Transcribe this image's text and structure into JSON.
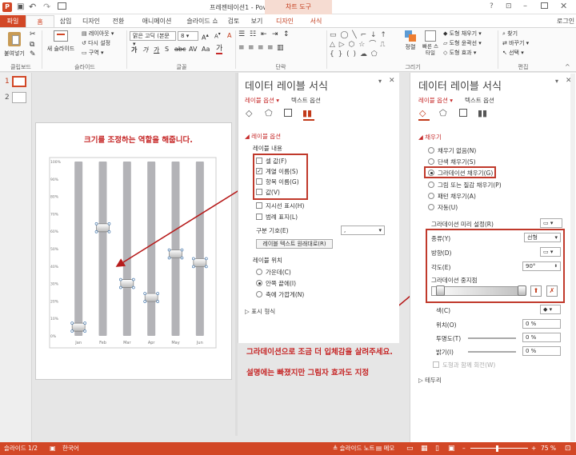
{
  "title": "프레젠테이션1 - PowerPoint",
  "chart_tools_label": "차트 도구",
  "user": "로그인",
  "tabs": [
    "파일",
    "홈",
    "삽입",
    "디자인",
    "전환",
    "애니메이션",
    "슬라이드 쇼",
    "검토",
    "보기",
    "디자인",
    "서식"
  ],
  "ribbon": {
    "paste": "붙여넣기",
    "clipboard": "클립보드",
    "new_slide": "새 슬라이드",
    "layout": "레이아웃",
    "reset": "다시 설정",
    "section": "구역",
    "slides_group": "슬라이드",
    "font_name": "맑은 고딕 (본문",
    "font_size": "8",
    "font_group": "글꼴",
    "paragraph_group": "단락",
    "drawing_group": "그리기",
    "arrange": "정렬",
    "quick_styles": "빠른 스타일",
    "shape_fill": "도형 채우기",
    "shape_outline": "도형 윤곽선",
    "shape_effects": "도형 효과",
    "find": "찾기",
    "replace": "바꾸기",
    "select": "선택",
    "editing_group": "편집"
  },
  "slide_numbers": [
    "1",
    "2"
  ],
  "annotations": {
    "top": "크기를 조정하는 역할을 해줍니다.",
    "bottom1": "그라데이션으로 조금 더 입체감을 살려주세요.",
    "bottom2": "설명에는 빠졌지만 그림자 효과도 지정"
  },
  "chart_data": {
    "type": "scatter",
    "categories": [
      "Jan",
      "Feb",
      "Mar",
      "Apr",
      "May",
      "Jun"
    ],
    "values": [
      5,
      62,
      30,
      22,
      47,
      42
    ],
    "ylim": [
      0,
      100
    ],
    "yticks": [
      "0%",
      "10%",
      "20%",
      "30%",
      "40%",
      "50%",
      "60%",
      "70%",
      "80%",
      "90%",
      "100%"
    ]
  },
  "pane1": {
    "title": "데이터 레이블 서식",
    "tab_label_options": "레이블 옵션",
    "tab_text_options": "텍스트 옵션",
    "section": "레이블 옵션",
    "label_contains": "레이블 내용",
    "checks": [
      {
        "label": "셀 값(F)",
        "checked": false
      },
      {
        "label": "계열 이름(S)",
        "checked": true
      },
      {
        "label": "항목 이름(G)",
        "checked": false
      },
      {
        "label": "값(V)",
        "checked": false
      },
      {
        "label": "지시선 표시(H)",
        "checked": false
      },
      {
        "label": "범례 표지(L)",
        "checked": false
      }
    ],
    "separator_label": "구분 기호(E)",
    "separator_value": ",",
    "reset_button": "레이블 텍스트 원래대로(R)",
    "position_label": "레이블 위치",
    "positions": [
      {
        "label": "가운데(C)",
        "selected": false
      },
      {
        "label": "안쪽 끝에(I)",
        "selected": true
      },
      {
        "label": "축에 가깝게(N)",
        "selected": false
      }
    ],
    "number_section": "표시 형식"
  },
  "pane2": {
    "title": "데이터 레이블 서식",
    "tab_label_options": "레이블 옵션",
    "tab_text_options": "텍스트 옵션",
    "fill_section": "채우기",
    "fills": [
      {
        "label": "채우기 없음(N)",
        "selected": false
      },
      {
        "label": "단색 채우기(S)",
        "selected": false
      },
      {
        "label": "그라데이션 채우기(G)",
        "selected": true
      },
      {
        "label": "그림 또는 질감 채우기(P)",
        "selected": false
      },
      {
        "label": "패턴 채우기(A)",
        "selected": false
      },
      {
        "label": "자동(U)",
        "selected": false
      }
    ],
    "preset_label": "그라데이션 미리 설정(R)",
    "type_label": "종류(Y)",
    "type_value": "선형",
    "direction_label": "방향(D)",
    "angle_label": "각도(E)",
    "angle_value": "90°",
    "stops_label": "그라데이션 중지점",
    "color_label": "색(C)",
    "position_label": "위치(O)",
    "position_value": "0 %",
    "transparency_label": "투명도(T)",
    "transparency_value": "0 %",
    "brightness_label": "밝기(I)",
    "brightness_value": "0 %",
    "rotate_label": "도형과 함께 회전(W)",
    "border_section": "테두리"
  },
  "status": {
    "slide": "슬라이드 1/2",
    "language": "한국어",
    "notes": "슬라이드 노트",
    "comments": "메모",
    "zoom": "75 %"
  }
}
